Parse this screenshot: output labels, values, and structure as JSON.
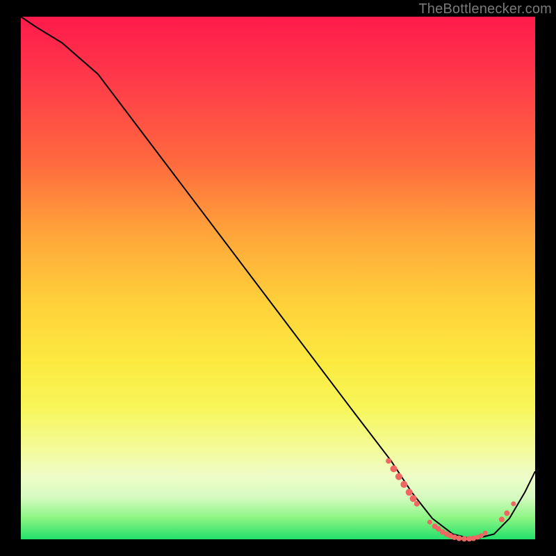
{
  "attribution": "TheBottlenecker.com",
  "colors": {
    "marker": "#ee6762",
    "curve": "#000000"
  },
  "chart_data": {
    "type": "line",
    "title": "",
    "xlabel": "",
    "ylabel": "",
    "xlim": [
      0,
      100
    ],
    "ylim": [
      0,
      100
    ],
    "series": [
      {
        "name": "curve",
        "x": [
          0,
          3,
          8,
          15,
          25,
          35,
          45,
          55,
          65,
          72,
          76,
          80,
          84,
          88,
          92,
          95,
          98,
          100
        ],
        "y": [
          100,
          98,
          95,
          89,
          76,
          63,
          50,
          37,
          24,
          15,
          9,
          4,
          1,
          0,
          1,
          4,
          9,
          13
        ]
      }
    ],
    "markers": {
      "name": "highlighted-points",
      "color_ref": "colors.marker",
      "points": [
        {
          "x": 71.5,
          "y": 15.0,
          "r": 4
        },
        {
          "x": 72.5,
          "y": 13.5,
          "r": 5
        },
        {
          "x": 73.5,
          "y": 12.0,
          "r": 5
        },
        {
          "x": 74.5,
          "y": 10.5,
          "r": 5
        },
        {
          "x": 75.5,
          "y": 9.0,
          "r": 5
        },
        {
          "x": 76.3,
          "y": 7.8,
          "r": 5
        },
        {
          "x": 77.0,
          "y": 6.8,
          "r": 4
        },
        {
          "x": 79.5,
          "y": 3.3,
          "r": 3.5
        },
        {
          "x": 80.5,
          "y": 2.5,
          "r": 4
        },
        {
          "x": 81.2,
          "y": 2.0,
          "r": 4
        },
        {
          "x": 82.0,
          "y": 1.4,
          "r": 4
        },
        {
          "x": 82.8,
          "y": 1.0,
          "r": 4
        },
        {
          "x": 83.5,
          "y": 0.7,
          "r": 4
        },
        {
          "x": 84.3,
          "y": 0.4,
          "r": 4
        },
        {
          "x": 85.2,
          "y": 0.2,
          "r": 4
        },
        {
          "x": 86.2,
          "y": 0.1,
          "r": 4
        },
        {
          "x": 87.2,
          "y": 0.1,
          "r": 4
        },
        {
          "x": 88.0,
          "y": 0.2,
          "r": 4
        },
        {
          "x": 88.8,
          "y": 0.4,
          "r": 3.5
        },
        {
          "x": 89.5,
          "y": 0.7,
          "r": 3.5
        },
        {
          "x": 90.3,
          "y": 1.2,
          "r": 3.5
        },
        {
          "x": 93.5,
          "y": 3.8,
          "r": 4
        },
        {
          "x": 94.5,
          "y": 5.0,
          "r": 4
        },
        {
          "x": 95.8,
          "y": 6.8,
          "r": 3.5
        }
      ]
    },
    "background_gradient_stops": [
      {
        "pos": 0,
        "color": "#ff1a4b"
      },
      {
        "pos": 12,
        "color": "#ff3a4a"
      },
      {
        "pos": 28,
        "color": "#ff6a3e"
      },
      {
        "pos": 42,
        "color": "#ffa73a"
      },
      {
        "pos": 55,
        "color": "#ffd13a"
      },
      {
        "pos": 66,
        "color": "#fcea3f"
      },
      {
        "pos": 75,
        "color": "#f7f65a"
      },
      {
        "pos": 83,
        "color": "#f3fb9c"
      },
      {
        "pos": 88,
        "color": "#eefcc8"
      },
      {
        "pos": 92,
        "color": "#d5fbc0"
      },
      {
        "pos": 96,
        "color": "#8af582"
      },
      {
        "pos": 100,
        "color": "#22e06c"
      }
    ]
  }
}
